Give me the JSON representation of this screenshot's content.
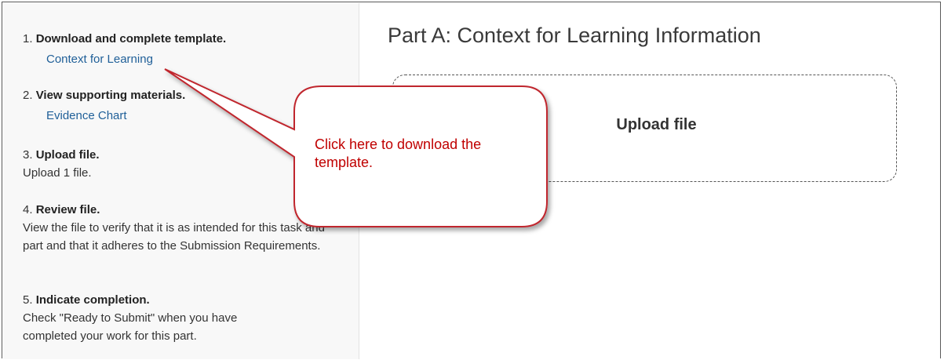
{
  "sidebar": {
    "steps": [
      {
        "num": "1.",
        "title": "Download and complete template.",
        "link": "Context for Learning"
      },
      {
        "num": "2.",
        "title": "View supporting materials.",
        "link": "Evidence Chart"
      },
      {
        "num": "3.",
        "title": "Upload file.",
        "desc": "Upload 1 file."
      },
      {
        "num": "4.",
        "title": "Review file.",
        "desc": "View the file to verify that it is as intended for this task and part and that it adheres to the Submission Requirements."
      },
      {
        "num": "5.",
        "title": "Indicate completion.",
        "desc": "Check \"Ready to Submit\" when you have completed your work for this part."
      }
    ]
  },
  "main": {
    "title": "Part A: Context for Learning Information",
    "upload_label": "Upload file"
  },
  "callout": {
    "text": "Click here to download the template."
  },
  "colors": {
    "link": "#1f5f98",
    "callout_text": "#c00000",
    "callout_border": "#c0282d"
  }
}
